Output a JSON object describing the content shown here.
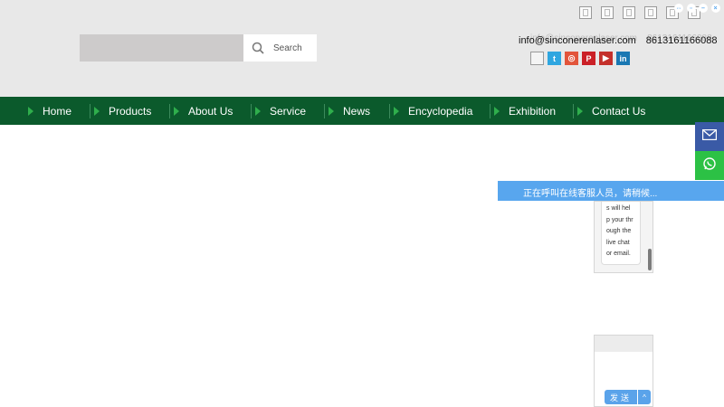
{
  "header": {
    "search": {
      "placeholder": "",
      "button_label": "Search"
    },
    "languages": [
      "lang-1",
      "lang-2",
      "lang-3",
      "lang-4",
      "lang-5",
      "lang-6"
    ],
    "contact": {
      "email": "info@sinconerenlaser.com",
      "phone": "8613161166088",
      "ghost_email": "info@sinconerenlaser.com",
      "ghost_phone": "8613161166088"
    },
    "social": [
      "doc-icon",
      "twitter-icon",
      "instagram-icon",
      "pinterest-icon",
      "youtube-icon",
      "linkedin-icon"
    ],
    "social_labels": {
      "twitter": "t",
      "instagram": "◎",
      "pinterest": "P",
      "youtube": "▶",
      "linkedin": "in"
    }
  },
  "nav": {
    "items": [
      "Home",
      "Products",
      "About Us",
      "Service",
      "News",
      "Encyclopedia",
      "Exhibition",
      "Contact Us"
    ]
  },
  "chat": {
    "status": "正在呼叫在线客服人员，请稍候...",
    "message_lines": [
      "s will hel",
      "p your thr",
      "ough the",
      "live chat",
      "or email."
    ],
    "send_label": "发送",
    "caret": "^"
  },
  "colors": {
    "nav_bg": "#0b5a2c",
    "nav_arrow": "#2fae4c",
    "chat_blue": "#58a6ee",
    "email_float": "#3a5aa6",
    "whatsapp_float": "#2cc145"
  }
}
